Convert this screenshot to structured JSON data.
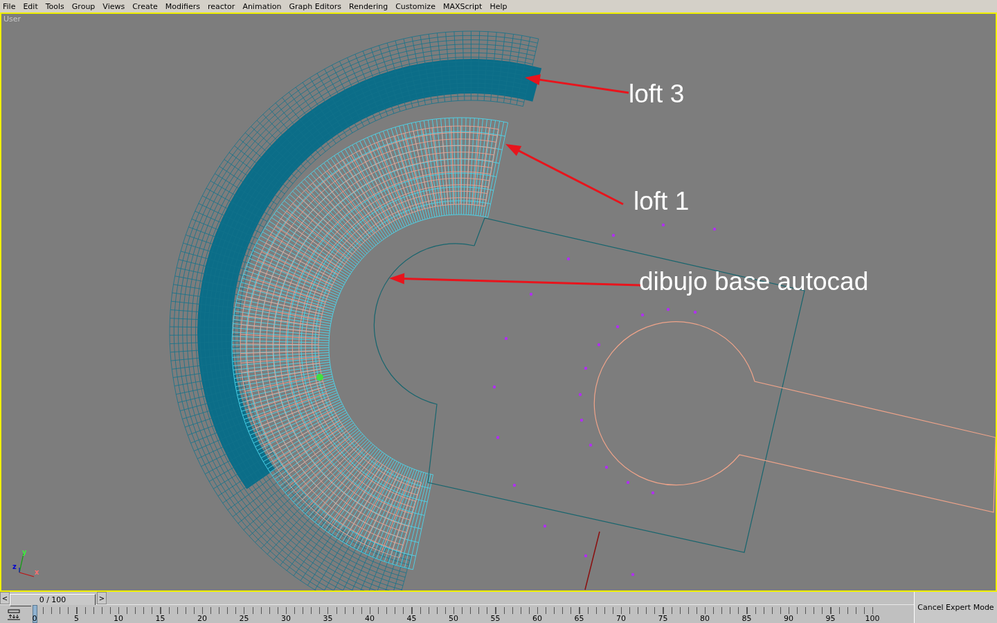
{
  "menu": [
    "File",
    "Edit",
    "Tools",
    "Group",
    "Views",
    "Create",
    "Modifiers",
    "reactor",
    "Animation",
    "Graph Editors",
    "Rendering",
    "Customize",
    "MAXScript",
    "Help"
  ],
  "viewport": {
    "label": "User",
    "active": true,
    "annotations": [
      "loft 3",
      "loft 1",
      "dibujo base autocad"
    ],
    "axis_labels": [
      "y",
      "z",
      "x"
    ]
  },
  "time_slider": {
    "prev": "<",
    "next": ">",
    "reading": "0 / 100",
    "level": 0
  },
  "timeline": {
    "ticks": [
      "0",
      "5",
      "10",
      "15",
      "20",
      "25",
      "30",
      "35",
      "40",
      "45",
      "50",
      "55",
      "60",
      "65",
      "70",
      "75",
      "80",
      "85",
      "90",
      "95",
      "100"
    ]
  },
  "expert_button": "Cancel Expert Mode"
}
